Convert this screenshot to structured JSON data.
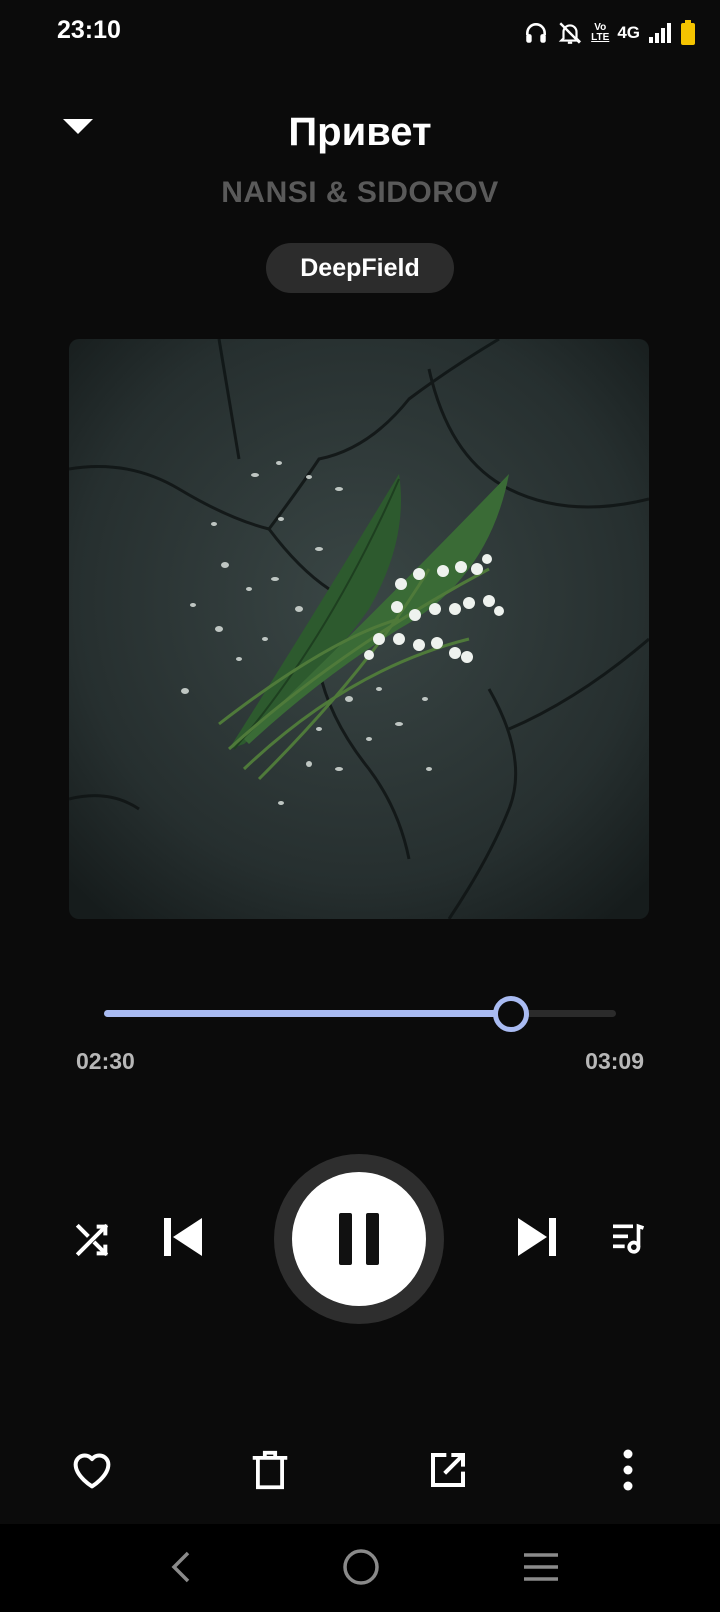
{
  "status_bar": {
    "time": "23:10",
    "network": "4G",
    "icons": [
      "headphones-icon",
      "notifications-off-icon",
      "volte-icon",
      "signal-icon",
      "battery-icon"
    ],
    "volte_top": "Vo",
    "volte_bottom": "LTE"
  },
  "track": {
    "title": "Привет",
    "artist": "NANSI & SIDOROV",
    "source": "DeepField"
  },
  "playback": {
    "current_time": "02:30",
    "total_time": "03:09",
    "progress": 0.794,
    "state": "playing"
  },
  "colors": {
    "background": "#0b0b0b",
    "accent": "#a9bbf2",
    "artist_text": "#5a5a5a",
    "chip_bg": "#2c2c2c"
  },
  "controls": [
    "shuffle-icon",
    "previous-icon",
    "pause-icon",
    "next-icon",
    "queue-icon"
  ],
  "actions": [
    "heart-icon",
    "trash-icon",
    "share-external-icon",
    "more-vertical-icon"
  ],
  "nav": [
    "back-icon",
    "home-icon",
    "recents-icon"
  ]
}
